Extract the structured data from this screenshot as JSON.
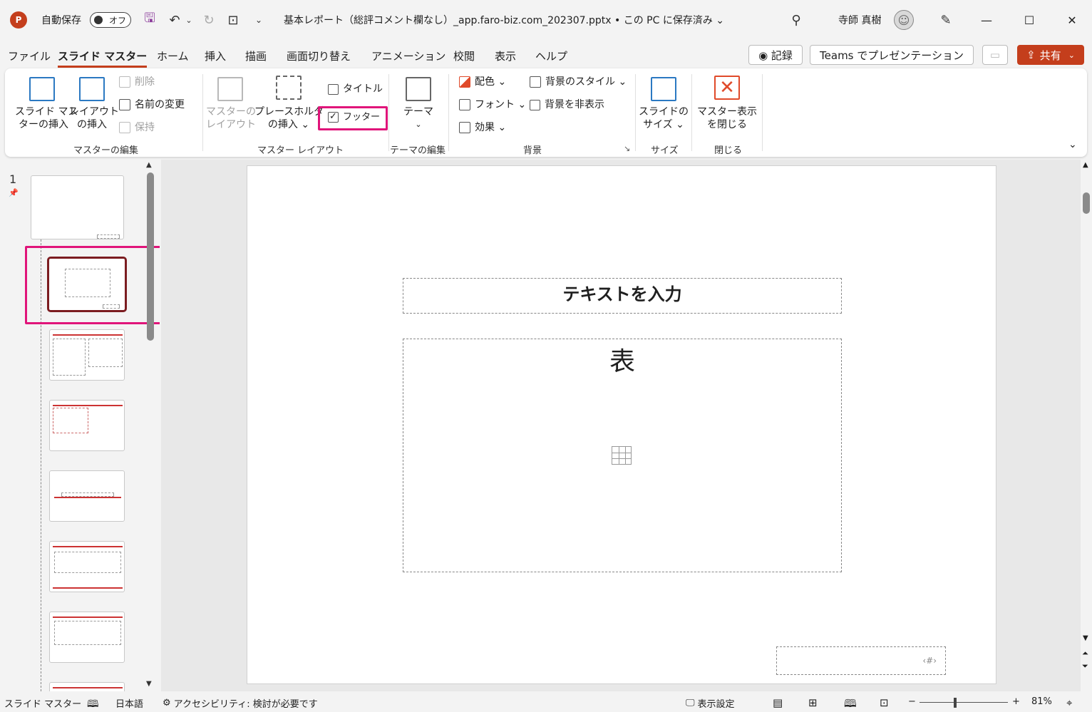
{
  "titlebar": {
    "app_logo": "P",
    "autosave_label": "自動保存",
    "autosave_state": "オフ",
    "doc_title": "基本レポート（総評コメント欄なし）_app.faro-biz.com_202307.pptx • この PC に保存済み ⌄",
    "user_name": "寺師 真樹"
  },
  "menu": {
    "tabs": [
      "ファイル",
      "スライド マスター",
      "ホーム",
      "挿入",
      "描画",
      "画面切り替え",
      "アニメーション",
      "校閲",
      "表示",
      "ヘルプ"
    ],
    "active_tab": "スライド マスター",
    "record": "◉ 記録",
    "teams": "Teams でプレゼンテーション",
    "share": "共有"
  },
  "ribbon": {
    "insert_master": [
      "スライド マス",
      "ターの挿入"
    ],
    "insert_layout": [
      "レイアウト",
      "の挿入"
    ],
    "delete": "削除",
    "rename": "名前の変更",
    "preserve": "保持",
    "group_edit_master": "マスターの編集",
    "master_layout": [
      "マスターの",
      "レイアウト"
    ],
    "insert_placeholder": [
      "プレースホルダー",
      "の挿入 ⌄"
    ],
    "title_chk": "タイトル",
    "footer_chk": "フッター",
    "group_master_layout": "マスター レイアウト",
    "themes": "テーマ",
    "group_edit_theme": "テーマの編集",
    "colors": "配色 ⌄",
    "fonts": "フォント ⌄",
    "effects": "効果 ⌄",
    "bg_styles": "背景のスタイル ⌄",
    "hide_bg": "背景を非表示",
    "group_background": "背景",
    "slide_size": [
      "スライドの",
      "サイズ ⌄"
    ],
    "group_size": "サイズ",
    "close_master": [
      "マスター表示",
      "を閉じる"
    ],
    "group_close": "閉じる"
  },
  "thumbnails": {
    "slide_number": "1"
  },
  "slide": {
    "title_placeholder": "テキストを入力",
    "content_placeholder": "表",
    "footer_number": "‹#›"
  },
  "status": {
    "view": "スライド マスター",
    "language": "日本語",
    "accessibility": "アクセシビリティ: 検討が必要です",
    "display_settings": "表示設定",
    "zoom": "81%"
  },
  "colors": {
    "accent": "#c43e1c",
    "highlight": "#e0147a",
    "selected_thumb": "#7b1c20"
  }
}
